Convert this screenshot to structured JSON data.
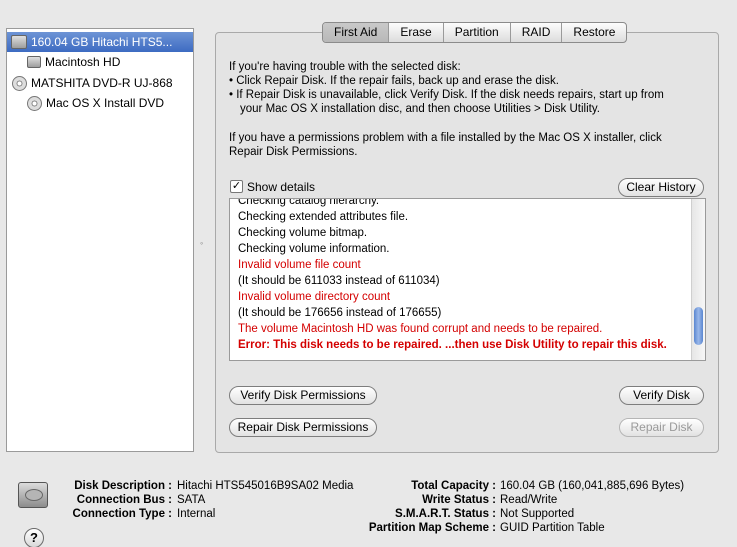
{
  "sidebar": {
    "items": [
      {
        "label": "160.04 GB Hitachi HTS5...",
        "icon": "hard-disk-icon"
      },
      {
        "label": "Macintosh HD",
        "icon": "volume-icon"
      },
      {
        "label": "MATSHITA DVD-R UJ-868",
        "icon": "optical-drive-icon"
      },
      {
        "label": "Mac OS X Install DVD",
        "icon": "dvd-icon"
      }
    ]
  },
  "tabs": [
    "First Aid",
    "Erase",
    "Partition",
    "RAID",
    "Restore"
  ],
  "active_tab": "First Aid",
  "info": {
    "trouble_heading": "If you're having trouble with the selected disk:",
    "bullet1": "• Click Repair Disk. If the repair fails, back up and erase the disk.",
    "bullet2a": "• If Repair Disk is unavailable, click Verify Disk. If the disk needs repairs, start up from",
    "bullet2b": "your Mac OS X installation disc, and then choose Utilities > Disk Utility.",
    "perm_line1": "If you have a permissions problem with a file installed by the Mac OS X installer, click",
    "perm_line2": "Repair Disk Permissions."
  },
  "show_details": {
    "label": "Show details",
    "checked": true,
    "mark": "✓"
  },
  "buttons": {
    "clear_history": "Clear History",
    "verify_permissions": "Verify Disk Permissions",
    "repair_permissions": "Repair Disk Permissions",
    "verify_disk": "Verify Disk",
    "repair_disk": "Repair Disk"
  },
  "log": [
    {
      "text": "Checking catalog hierarchy.",
      "style": "normal"
    },
    {
      "text": "Checking extended attributes file.",
      "style": "normal"
    },
    {
      "text": "Checking volume bitmap.",
      "style": "normal"
    },
    {
      "text": "Checking volume information.",
      "style": "normal"
    },
    {
      "text": "Invalid volume file count",
      "style": "red"
    },
    {
      "text": "(It should be 611033 instead of 611034)",
      "style": "normal"
    },
    {
      "text": "Invalid volume directory count",
      "style": "red"
    },
    {
      "text": "(It should be 176656 instead of 176655)",
      "style": "normal"
    },
    {
      "text": "The volume Macintosh HD was found corrupt and needs to be repaired.",
      "style": "red"
    },
    {
      "text": "Error: This disk needs to be repaired. ...then use Disk Utility to repair this disk.",
      "style": "red-bold"
    }
  ],
  "disk_info": {
    "left": [
      {
        "key": "Disk Description :",
        "value": "Hitachi HTS545016B9SA02 Media"
      },
      {
        "key": "Connection Bus :",
        "value": "SATA"
      },
      {
        "key": "Connection Type :",
        "value": "Internal"
      }
    ],
    "right": [
      {
        "key": "Total Capacity :",
        "value": "160.04 GB (160,041,885,696 Bytes)"
      },
      {
        "key": "Write Status :",
        "value": "Read/Write"
      },
      {
        "key": "S.M.A.R.T. Status :",
        "value": "Not Supported"
      },
      {
        "key": "Partition Map Scheme :",
        "value": "GUID Partition Table"
      }
    ]
  },
  "help_symbol": "?",
  "colors": {
    "error_red": "#d40000",
    "selection_blue": "#3d6bc2"
  }
}
